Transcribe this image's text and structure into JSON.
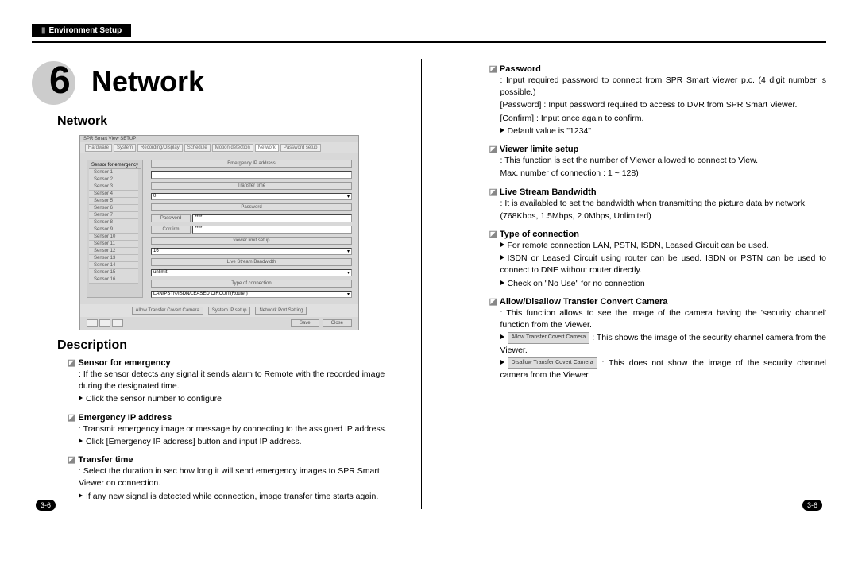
{
  "header": {
    "tab_label": "Environment Setup"
  },
  "chapter": {
    "number": "6",
    "title": "Network"
  },
  "section_title": "Network",
  "description_title": "Description",
  "page_number_left": "3-6",
  "page_number_right": "3-6",
  "screenshot": {
    "window_title": "SPR Smart View SETUP",
    "tabs": [
      "Hardware",
      "System",
      "Recording/Display",
      "Schedule",
      "Motion detection",
      "Network",
      "Password setup"
    ],
    "active_tab_index": 5,
    "sensor_header": "Sensor for emergency",
    "sensors": [
      "Sensor 1",
      "Sensor 2",
      "Sensor 3",
      "Sensor 4",
      "Sensor 5",
      "Sensor 6",
      "Sensor 7",
      "Sensor 8",
      "Sensor 9",
      "Sensor 10",
      "Sensor 11",
      "Sensor 12",
      "Sensor 13",
      "Sensor 14",
      "Sensor 15",
      "Sensor 16"
    ],
    "labels": {
      "emergency_ip": "Emergency IP address",
      "transfer_time": "Transfer time",
      "transfer_time_val": "0",
      "password": "Password",
      "password_lbl": "Password",
      "password_val": "****",
      "confirm_lbl": "Confirm",
      "confirm_val": "****",
      "viewer_limit": "viewer limit setup",
      "viewer_limit_val": "16",
      "live_stream": "Live Stream Bandwidth",
      "live_stream_val": "unlimit",
      "conn_type": "Type of connection",
      "conn_type_val": "LAN/PSTN/ISDN/LEASED CIRCUIT(Router)"
    },
    "bottom_buttons": [
      "Allow Transfer Covert Camera",
      "System IP setup",
      "Network Port Setting"
    ],
    "footer_buttons": [
      "Save",
      "Close"
    ]
  },
  "left_items": [
    {
      "title": "Sensor for emergency",
      "lines": [
        ": If the sensor detects any signal it sends alarm to Remote with the recorded image during the designated time.",
        "▶Click the sensor number to configure"
      ]
    },
    {
      "title": "Emergency IP address",
      "lines": [
        ": Transmit emergency image or message by connecting to the assigned IP address.",
        "▶Click [Emergency IP address] button and input IP address."
      ]
    },
    {
      "title": "Transfer time",
      "lines": [
        ": Select the duration in sec how long it will send emergency images to SPR Smart Viewer on connection.",
        "▶If any new signal is detected while connection, image transfer time starts again."
      ]
    }
  ],
  "right_items": [
    {
      "title": "Password",
      "lines": [
        ": Input required password to connect from SPR Smart Viewer p.c. (4 digit number is possible.)",
        "[Password] : Input password required to access to DVR from SPR Smart Viewer.",
        "[Confirm]    : Input once again to confirm.",
        "▶Default value is  \"1234\""
      ]
    },
    {
      "title": "Viewer limite setup",
      "lines": [
        ": This function is set the number of Viewer allowed to connect to View.",
        "Max. number of connection : 1 ~ 128)"
      ]
    },
    {
      "title": "Live Stream Bandwidth",
      "lines": [
        ": It is availabled to set the bandwidth when transmitting the picture data by network.",
        "(768Kbps, 1.5Mbps, 2.0Mbps, Unlimited)"
      ]
    },
    {
      "title": "Type of connection",
      "lines": [
        "▶For remote connection LAN, PSTN, ISDN, Leased Circuit can be used.",
        "▶ISDN or Leased Circuit using router can be used. ISDN or PSTN can be used to connect to DNE without router directly.",
        "▶Check on  \"No Use\"  for no connection"
      ]
    },
    {
      "title": "Allow/Disallow Transfer Convert Camera",
      "lines": [
        ": This function allows to see the image of the camera having the 'security channel' function from the Viewer."
      ],
      "buttons": [
        {
          "label": "Allow Transfer Covert Camera",
          "text": ": This shows the image of the security channel camera from the Viewer."
        },
        {
          "label": "Disallow Transfer Covert Camera",
          "text": ": This does not show the image of the security channel camera from the Viewer."
        }
      ]
    }
  ]
}
